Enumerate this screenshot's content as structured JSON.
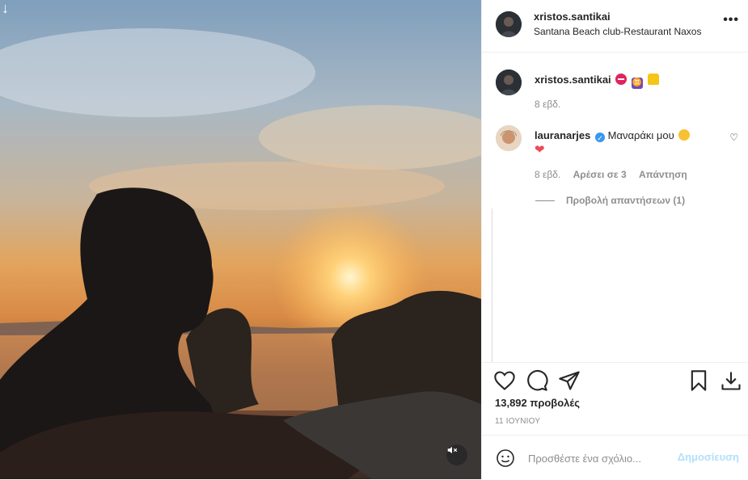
{
  "header": {
    "username": "xristos.santikai",
    "location": "Santana Beach club-Restaurant Naxos",
    "more_glyph": "•••"
  },
  "caption": {
    "username": "xristos.santikai",
    "emojis": [
      "no-entry-icon",
      "gemini-icon",
      "lock-icon"
    ],
    "time": "8 εβδ."
  },
  "comment": {
    "username": "lauranarjes",
    "text": "Μαναράκι μου",
    "verified": true,
    "time": "8 εβδ.",
    "likes": "Αρέσει σε 3",
    "reply": "Απάντηση",
    "view_replies": "Προβολή απαντήσεων (1)"
  },
  "actions": {
    "views": "13,892 προβολές",
    "date": "11 ΙΟΥΝΙΟΥ"
  },
  "add_comment": {
    "placeholder": "Προσθέστε ένα σχόλιο...",
    "post_label": "Δημοσίευση"
  },
  "colors": {
    "accent": "#0095f6",
    "post_disabled": "#b2dffc",
    "heart": "#ed4956",
    "verified": "#3897f0"
  }
}
